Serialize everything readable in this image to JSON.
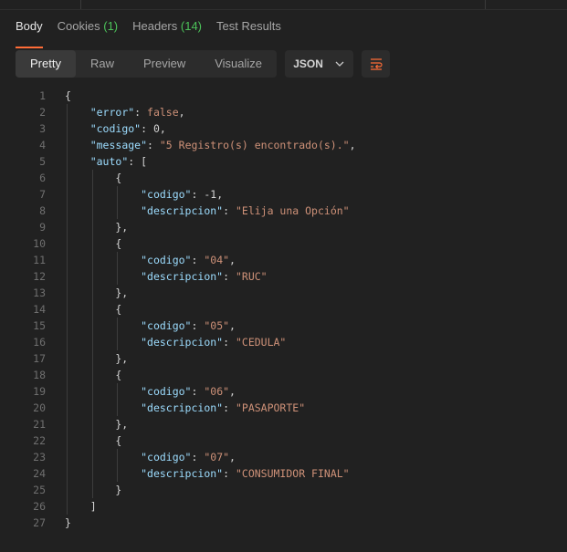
{
  "tabs": [
    {
      "label": "Body",
      "count": ""
    },
    {
      "label": "Cookies",
      "count": "(1)"
    },
    {
      "label": "Headers",
      "count": "(14)"
    },
    {
      "label": "Test Results",
      "count": ""
    }
  ],
  "view_modes": [
    "Pretty",
    "Raw",
    "Preview",
    "Visualize"
  ],
  "format": "JSON",
  "icons": {
    "format_dropdown": "chevron-down-icon",
    "wrap": "wrap-lines-icon"
  },
  "colors": {
    "accent": "#ff6c37",
    "count": "#4cc35a",
    "key": "#9cdcfe",
    "string": "#ce9178",
    "keyword": "#569cd6"
  },
  "code_lines": [
    "{",
    "    \"error\": false,",
    "    \"codigo\": 0,",
    "    \"message\": \"5 Registro(s) encontrado(s).\",",
    "    \"auto\": [",
    "        {",
    "            \"codigo\": -1,",
    "            \"descripcion\": \"Elija una Opción\"",
    "        },",
    "        {",
    "            \"codigo\": \"04\",",
    "            \"descripcion\": \"RUC\"",
    "        },",
    "        {",
    "            \"codigo\": \"05\",",
    "            \"descripcion\": \"CEDULA\"",
    "        },",
    "        {",
    "            \"codigo\": \"06\",",
    "            \"descripcion\": \"PASAPORTE\"",
    "        },",
    "        {",
    "            \"codigo\": \"07\",",
    "            \"descripcion\": \"CONSUMIDOR FINAL\"",
    "        }",
    "    ]",
    "}"
  ]
}
